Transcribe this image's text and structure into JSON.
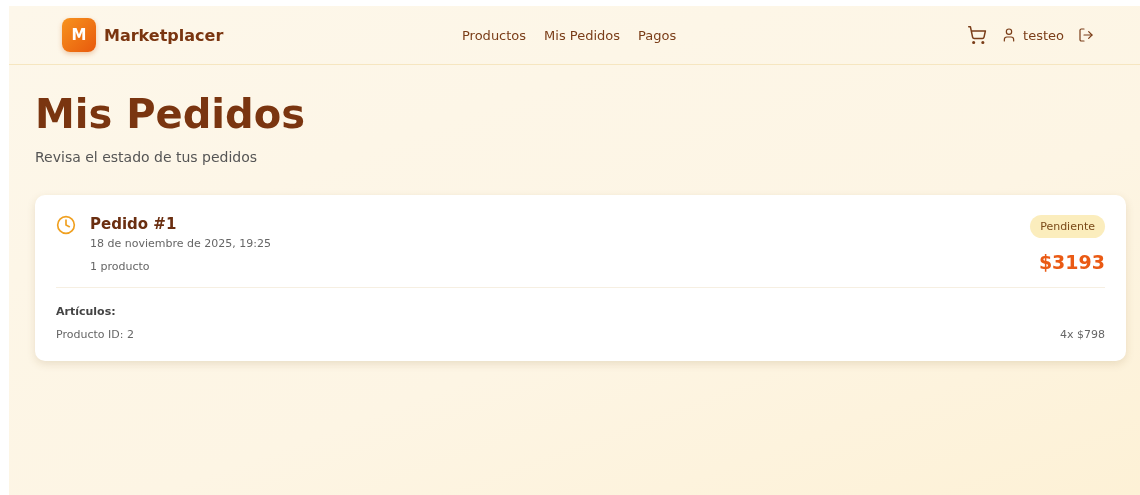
{
  "header": {
    "logo_letter": "M",
    "brand": "Marketplacer",
    "nav": [
      "Productos",
      "Mis Pedidos",
      "Pagos"
    ],
    "user": "testeo"
  },
  "page": {
    "title": "Mis Pedidos",
    "subtitle": "Revisa el estado de tus pedidos"
  },
  "orders": [
    {
      "title": "Pedido #1",
      "date": "18 de noviembre de 2025, 19:25",
      "count": "1 producto",
      "status": "Pendiente",
      "total": "$3193",
      "items_label": "Artículos:",
      "items": [
        {
          "name": "Producto ID: 2",
          "qty_price": "4x $798"
        }
      ]
    }
  ]
}
